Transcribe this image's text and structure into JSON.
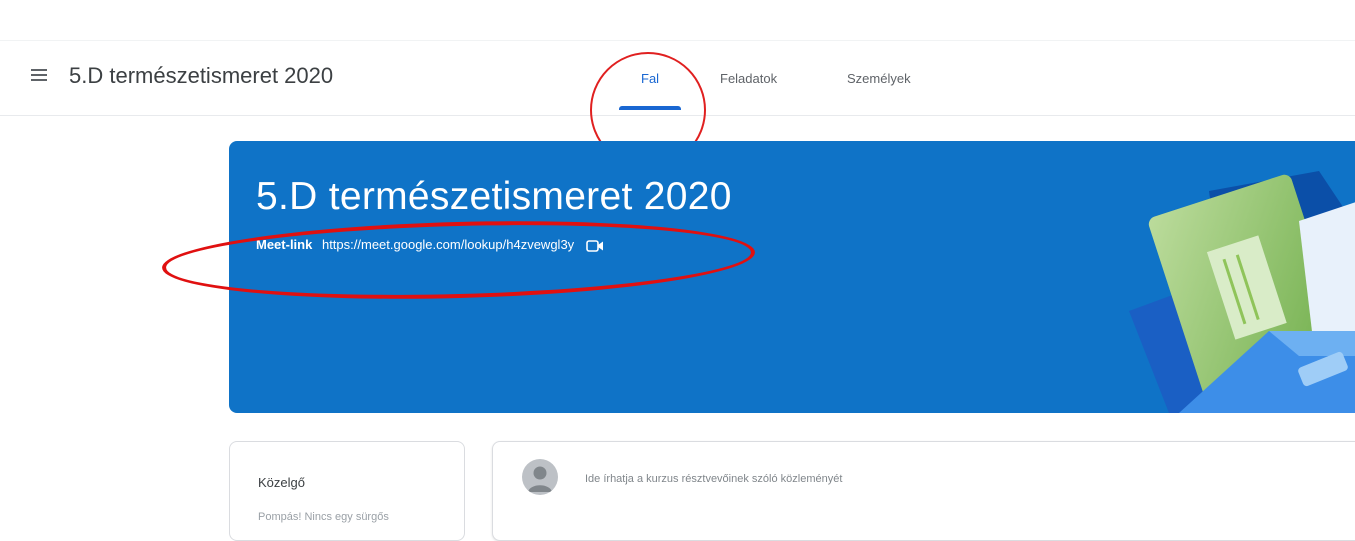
{
  "header": {
    "course_name": "5.D természetismeret 2020",
    "tabs": [
      {
        "label": "Fal",
        "active": true
      },
      {
        "label": "Feladatok",
        "active": false
      },
      {
        "label": "Személyek",
        "active": false
      }
    ]
  },
  "banner": {
    "title": "5.D természetismeret 2020",
    "meet_label": "Meet-link",
    "meet_url": "https://meet.google.com/lookup/h4zvewgl3y",
    "background_color": "#0f73c7"
  },
  "upcoming": {
    "title": "Közelgő",
    "text": "Pompás! Nincs egy sürgős"
  },
  "stream": {
    "announce_placeholder": "Ide írhatja a kurzus résztvevőinek szóló közleményét"
  },
  "colors": {
    "accent": "#1967d2",
    "annotation_red": "#e02020"
  }
}
